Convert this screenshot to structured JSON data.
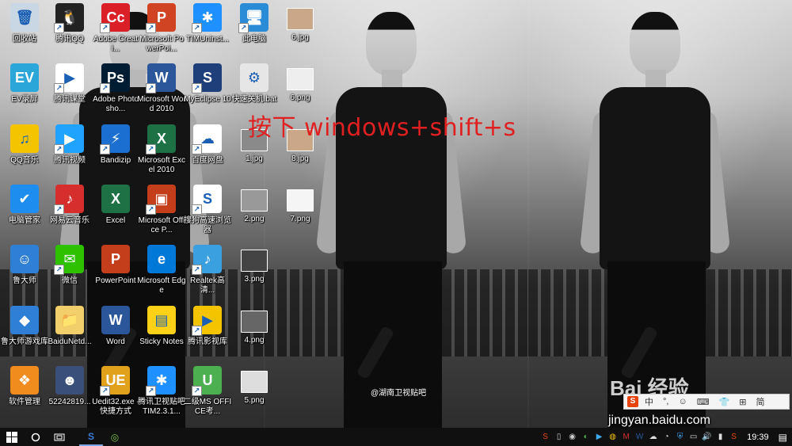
{
  "overlay": {
    "instruction": "按下 windows+shift+s",
    "watermark_small": "@湖南卫视贴吧",
    "watermark_baidu": "Bai 经验",
    "watermark_site": "jingyan.baidu.com"
  },
  "desktop_icons": [
    {
      "label": "回收站",
      "icon": "recycle-bin-icon",
      "color": "#c9d6e3",
      "glyph": "🗑",
      "shortcut": false
    },
    {
      "label": "EV录屏",
      "icon": "ev-recorder-icon",
      "color": "#2aa6d9",
      "glyph": "EV",
      "shortcut": false
    },
    {
      "label": "QQ音乐",
      "icon": "qq-music-icon",
      "color": "#f5c400",
      "glyph": "♫",
      "shortcut": false
    },
    {
      "label": "电脑管家",
      "icon": "pc-manager-icon",
      "color": "#1e8df0",
      "glyph": "✔",
      "shortcut": false
    },
    {
      "label": "鲁大师",
      "icon": "ludashi-icon",
      "color": "#2f7fd6",
      "glyph": "☺",
      "shortcut": false
    },
    {
      "label": "鲁大师游戏库",
      "icon": "game-library-icon",
      "color": "#2f7fd6",
      "glyph": "◆",
      "shortcut": false
    },
    {
      "label": "软件管理",
      "icon": "software-manager-icon",
      "color": "#f08b1d",
      "glyph": "❖",
      "shortcut": false
    },
    {
      "label": "腾讯QQ",
      "icon": "qq-icon",
      "color": "#222222",
      "glyph": "🐧",
      "shortcut": true
    },
    {
      "label": "腾讯课堂",
      "icon": "tencent-classroom-icon",
      "color": "#ffffff",
      "glyph": "▶",
      "shortcut": true
    },
    {
      "label": "腾讯视频",
      "icon": "tencent-video-icon",
      "color": "#1fa3ff",
      "glyph": "▶",
      "shortcut": true
    },
    {
      "label": "网易云音乐",
      "icon": "netease-music-icon",
      "color": "#d62d2d",
      "glyph": "♪",
      "shortcut": true
    },
    {
      "label": "微信",
      "icon": "wechat-icon",
      "color": "#2dc100",
      "glyph": "✉",
      "shortcut": true
    },
    {
      "label": "BaiduNetd...",
      "icon": "baidu-netdisk-icon",
      "color": "#f2cf6b",
      "glyph": "📁",
      "shortcut": false
    },
    {
      "label": "52242819...",
      "icon": "photo-file-icon",
      "color": "#3a4f7a",
      "glyph": "☻",
      "shortcut": false
    },
    {
      "label": "Adobe Creati...",
      "icon": "adobe-cc-icon",
      "color": "#da1f26",
      "glyph": "Cc",
      "shortcut": true
    },
    {
      "label": "Adobe Photosho...",
      "icon": "photoshop-icon",
      "color": "#001d34",
      "glyph": "Ps",
      "shortcut": true
    },
    {
      "label": "Bandizip",
      "icon": "bandizip-icon",
      "color": "#1a6fd1",
      "glyph": "⚡",
      "shortcut": true
    },
    {
      "label": "Excel",
      "icon": "excel-icon",
      "color": "#1e7145",
      "glyph": "X",
      "shortcut": false
    },
    {
      "label": "PowerPoint",
      "icon": "powerpoint-icon",
      "color": "#c43e1c",
      "glyph": "P",
      "shortcut": false
    },
    {
      "label": "Word",
      "icon": "word-icon",
      "color": "#2b579a",
      "glyph": "W",
      "shortcut": false
    },
    {
      "label": "Uedit32.exe - 快捷方式",
      "icon": "ultraedit-icon",
      "color": "#e2a11b",
      "glyph": "UE",
      "shortcut": true
    },
    {
      "label": "Microsoft PowerPoi...",
      "icon": "powerpoint-2010-icon",
      "color": "#d04423",
      "glyph": "P",
      "shortcut": true
    },
    {
      "label": "Microsoft Word 2010",
      "icon": "word-2010-icon",
      "color": "#2b579a",
      "glyph": "W",
      "shortcut": true
    },
    {
      "label": "Microsoft Excel 2010",
      "icon": "excel-2010-icon",
      "color": "#1e7145",
      "glyph": "X",
      "shortcut": true
    },
    {
      "label": "Microsoft Office P...",
      "icon": "office-picture-icon",
      "color": "#c43e1c",
      "glyph": "▣",
      "shortcut": true
    },
    {
      "label": "Microsoft Edge",
      "icon": "edge-icon",
      "color": "#0078d7",
      "glyph": "e",
      "shortcut": false
    },
    {
      "label": "Sticky Notes",
      "icon": "sticky-notes-icon",
      "color": "#fcd116",
      "glyph": "▤",
      "shortcut": false
    },
    {
      "label": "腾讯卫视贴吧 TIM2.3.1...",
      "icon": "tim-installer-icon",
      "color": "#1e90ff",
      "glyph": "✱",
      "shortcut": true
    },
    {
      "label": "TIMUninst...",
      "icon": "tim-uninstall-icon",
      "color": "#1e90ff",
      "glyph": "✱",
      "shortcut": true
    },
    {
      "label": "MyEclipse 10",
      "icon": "myeclipse-icon",
      "color": "#1f3f7a",
      "glyph": "S",
      "shortcut": true
    },
    {
      "label": "百度网盘",
      "icon": "baidu-pan-icon",
      "color": "#ffffff",
      "glyph": "☁",
      "shortcut": true
    },
    {
      "label": "搜狗高速浏览器",
      "icon": "sogou-browser-icon",
      "color": "#ffffff",
      "glyph": "S",
      "shortcut": true
    },
    {
      "label": "Realtek高清...",
      "icon": "realtek-icon",
      "color": "#3aa0e0",
      "glyph": "♪",
      "shortcut": true
    },
    {
      "label": "腾讯影视库",
      "icon": "tencent-film-library-icon",
      "color": "#f5c400",
      "glyph": "▶",
      "shortcut": true
    },
    {
      "label": "二级MS OFFICE考...",
      "icon": "ms-office-exam-icon",
      "color": "#4caf50",
      "glyph": "U",
      "shortcut": true
    },
    {
      "label": "此电脑",
      "icon": "this-pc-icon",
      "color": "#2a8bd6",
      "glyph": "🖥",
      "shortcut": true
    },
    {
      "label": "快速关机.bat",
      "icon": "bat-file-icon",
      "color": "#e6e6e6",
      "glyph": "⚙",
      "shortcut": false
    },
    {
      "label": "1.jpg",
      "icon": "image-thumb-icon",
      "color": "#8a8a8a",
      "glyph": "",
      "shortcut": false
    },
    {
      "label": "2.png",
      "icon": "image-thumb-icon",
      "color": "#999999",
      "glyph": "",
      "shortcut": false
    },
    {
      "label": "3.png",
      "icon": "image-thumb-icon",
      "color": "#444444",
      "glyph": "",
      "shortcut": false
    },
    {
      "label": "4.png",
      "icon": "image-thumb-icon",
      "color": "#666666",
      "glyph": "",
      "shortcut": false
    },
    {
      "label": "5.png",
      "icon": "image-thumb-icon",
      "color": "#dddddd",
      "glyph": "",
      "shortcut": false
    },
    {
      "label": "6.jpg",
      "icon": "image-thumb-icon",
      "color": "#c9a788",
      "glyph": "",
      "shortcut": false
    },
    {
      "label": "6.png",
      "icon": "image-thumb-icon",
      "color": "#eeeeee",
      "glyph": "",
      "shortcut": false
    },
    {
      "label": "8.jpg",
      "icon": "image-thumb-icon",
      "color": "#c9a788",
      "glyph": "",
      "shortcut": false
    },
    {
      "label": "7.png",
      "icon": "image-thumb-icon",
      "color": "#f5f5f5",
      "glyph": "",
      "shortcut": false
    }
  ],
  "ime_bar": {
    "items": [
      "中",
      "°,",
      "☺",
      "⌨",
      "👕",
      "⊞",
      "简"
    ]
  },
  "taskbar": {
    "start_icon": "windows-start-icon",
    "cortana_icon": "cortana-icon",
    "taskview_icon": "task-view-icon",
    "apps": [
      {
        "name": "sogou-browser-taskbar-icon",
        "glyph": "S",
        "color": "#3a7bd5",
        "active": true
      },
      {
        "name": "ms-office-exam-taskbar-icon",
        "glyph": "◎",
        "color": "#7cc242",
        "active": false
      }
    ],
    "tray_icons": [
      {
        "name": "sogou-ime-tray-icon",
        "glyph": "S",
        "color": "#e8450e"
      },
      {
        "name": "usb-tray-icon",
        "glyph": "▯",
        "color": "#cccccc"
      },
      {
        "name": "network-status-tray-icon",
        "glyph": "◉",
        "color": "#cccccc"
      },
      {
        "name": "video-player-tray-icon",
        "glyph": "◐",
        "color": "#4caf50"
      },
      {
        "name": "media-tray-icon",
        "glyph": "▶",
        "color": "#3fa9f5"
      },
      {
        "name": "security-tray-icon",
        "glyph": "◍",
        "color": "#f0c000"
      },
      {
        "name": "mcafee-tray-icon",
        "glyph": "M",
        "color": "#d32f2f"
      },
      {
        "name": "word-tray-icon",
        "glyph": "W",
        "color": "#2b579a"
      },
      {
        "name": "cloud-tray-icon",
        "glyph": "☁",
        "color": "#dddddd"
      },
      {
        "name": "wifi-tray-icon",
        "glyph": "◔",
        "color": "#dddddd"
      },
      {
        "name": "shield-tray-icon",
        "glyph": "⛨",
        "color": "#3fa9f5"
      },
      {
        "name": "display-tray-icon",
        "glyph": "▭",
        "color": "#dddddd"
      },
      {
        "name": "volume-tray-icon",
        "glyph": "🔊",
        "color": "#dddddd"
      },
      {
        "name": "battery-tray-icon",
        "glyph": "▮",
        "color": "#dddddd"
      },
      {
        "name": "sogou-input-tray-icon",
        "glyph": "S",
        "color": "#e8450e"
      }
    ],
    "clock": "19:39",
    "notification_icon": "notification-icon"
  }
}
